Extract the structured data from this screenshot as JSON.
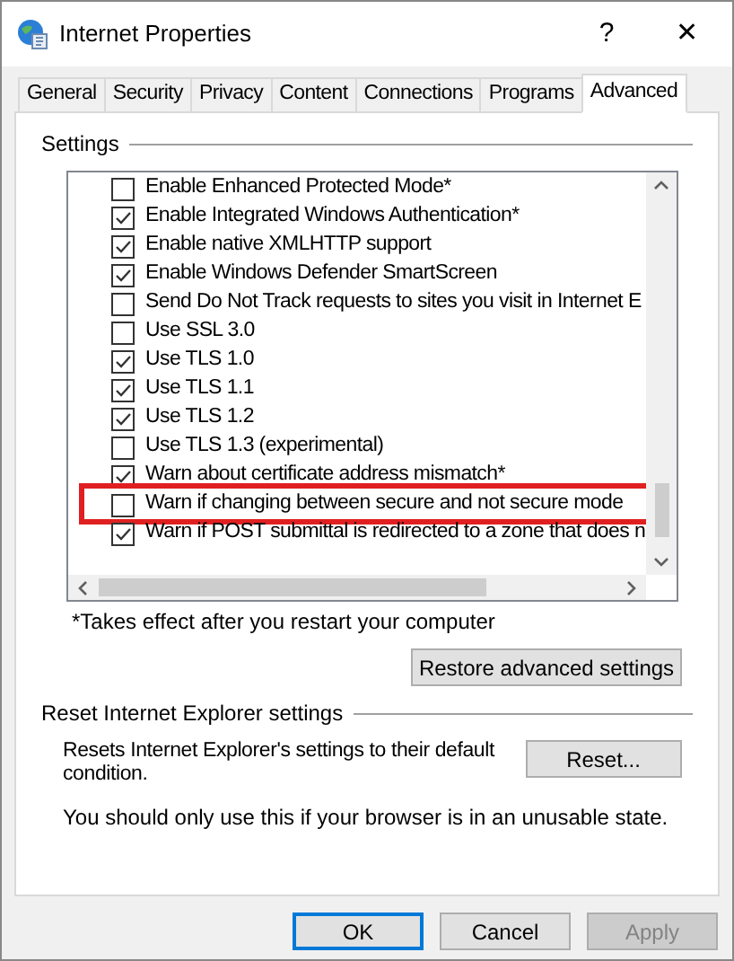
{
  "window": {
    "title": "Internet Properties",
    "help": "?",
    "close": "✕"
  },
  "tabs": [
    {
      "label": "General",
      "selected": false
    },
    {
      "label": "Security",
      "selected": false
    },
    {
      "label": "Privacy",
      "selected": false
    },
    {
      "label": "Content",
      "selected": false
    },
    {
      "label": "Connections",
      "selected": false
    },
    {
      "label": "Programs",
      "selected": false
    },
    {
      "label": "Advanced",
      "selected": true
    }
  ],
  "settings": {
    "title": "Settings",
    "items": [
      {
        "label": "Enable Enhanced Protected Mode*",
        "checked": false,
        "highlighted": false
      },
      {
        "label": "Enable Integrated Windows Authentication*",
        "checked": true,
        "highlighted": false
      },
      {
        "label": "Enable native XMLHTTP support",
        "checked": true,
        "highlighted": false
      },
      {
        "label": "Enable Windows Defender SmartScreen",
        "checked": true,
        "highlighted": false
      },
      {
        "label": "Send Do Not Track requests to sites you visit in Internet E",
        "checked": false,
        "highlighted": false
      },
      {
        "label": "Use SSL 3.0",
        "checked": false,
        "highlighted": false
      },
      {
        "label": "Use TLS 1.0",
        "checked": true,
        "highlighted": false
      },
      {
        "label": "Use TLS 1.1",
        "checked": true,
        "highlighted": false
      },
      {
        "label": "Use TLS 1.2",
        "checked": true,
        "highlighted": false
      },
      {
        "label": "Use TLS 1.3 (experimental)",
        "checked": false,
        "highlighted": false
      },
      {
        "label": "Warn about certificate address mismatch*",
        "checked": true,
        "highlighted": false
      },
      {
        "label": "Warn if changing between secure and not secure mode",
        "checked": false,
        "highlighted": true
      },
      {
        "label": "Warn if POST submittal is redirected to a zone that does n",
        "checked": true,
        "highlighted": false
      }
    ],
    "note": "*Takes effect after you restart your computer",
    "restore_button": "Restore advanced settings"
  },
  "reset": {
    "title": "Reset Internet Explorer settings",
    "description": "Resets Internet Explorer's settings to their default condition.",
    "button": "Reset...",
    "warning": "You should only use this if your browser is in an unusable state."
  },
  "buttons": [
    {
      "label": "OK",
      "kind": "default",
      "disabled": false
    },
    {
      "label": "Cancel",
      "kind": "normal",
      "disabled": false
    },
    {
      "label": "Apply",
      "kind": "normal",
      "disabled": true
    }
  ]
}
